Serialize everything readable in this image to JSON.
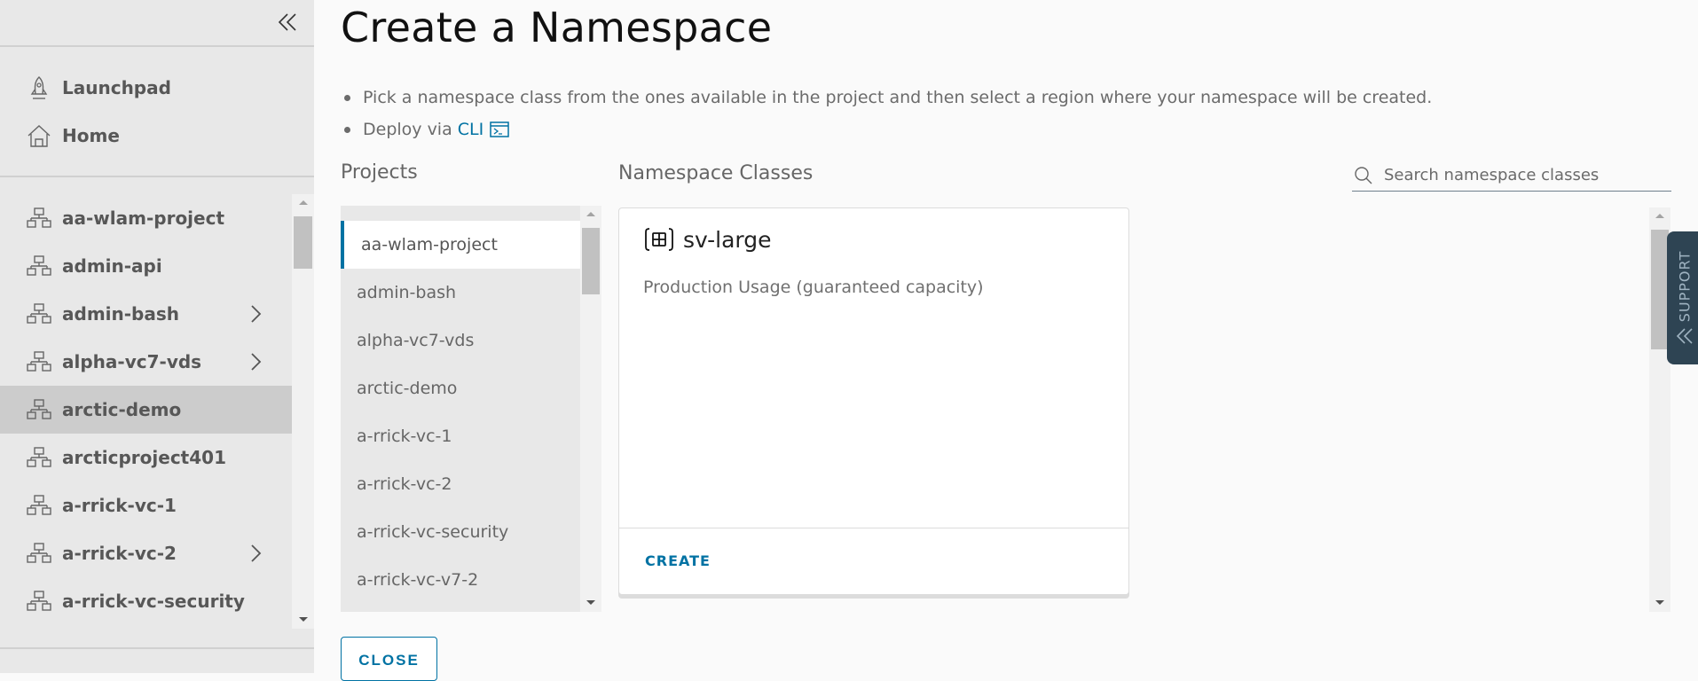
{
  "sidebar": {
    "collapse_icon": "double-chevron-left-icon",
    "top_items": [
      {
        "label": "Launchpad",
        "icon": "rocket-icon"
      },
      {
        "label": "Home",
        "icon": "home-icon"
      }
    ],
    "projects": [
      {
        "label": "aa-wlam-project",
        "expandable": false,
        "selected": false
      },
      {
        "label": "admin-api",
        "expandable": false,
        "selected": false
      },
      {
        "label": "admin-bash",
        "expandable": true,
        "selected": false
      },
      {
        "label": "alpha-vc7-vds",
        "expandable": true,
        "selected": false
      },
      {
        "label": "arctic-demo",
        "expandable": false,
        "selected": true
      },
      {
        "label": "arcticproject401",
        "expandable": false,
        "selected": false
      },
      {
        "label": "a-rrick-vc-1",
        "expandable": false,
        "selected": false
      },
      {
        "label": "a-rrick-vc-2",
        "expandable": true,
        "selected": false
      },
      {
        "label": "a-rrick-vc-security",
        "expandable": false,
        "selected": false
      }
    ]
  },
  "main": {
    "title": "Create a Namespace",
    "instructions": [
      "Pick a namespace class from the ones available in the project and then select a region where your namespace will be created.",
      "Deploy via"
    ],
    "cli_link": "CLI",
    "projects_label": "Projects",
    "project_list": [
      {
        "label": "aa-wlam-project",
        "selected": true
      },
      {
        "label": "admin-bash",
        "selected": false
      },
      {
        "label": "alpha-vc7-vds",
        "selected": false
      },
      {
        "label": "arctic-demo",
        "selected": false
      },
      {
        "label": "a-rrick-vc-1",
        "selected": false
      },
      {
        "label": "a-rrick-vc-2",
        "selected": false
      },
      {
        "label": "a-rrick-vc-security",
        "selected": false
      },
      {
        "label": "a-rrick-vc-v7-2",
        "selected": false
      }
    ],
    "namespace_classes_label": "Namespace Classes",
    "search": {
      "placeholder": "Search namespace classes",
      "value": ""
    },
    "classes": [
      {
        "name": "sv-large",
        "description": "Production Usage (guaranteed capacity)",
        "action": "CREATE"
      }
    ],
    "close_label": "CLOSE"
  },
  "support": {
    "label": "SUPPORT"
  },
  "colors": {
    "accent": "#0072a3",
    "sidebar_bg": "#e8e8e8",
    "selected_bg": "#cccccc",
    "support_bg": "#2e4453"
  }
}
